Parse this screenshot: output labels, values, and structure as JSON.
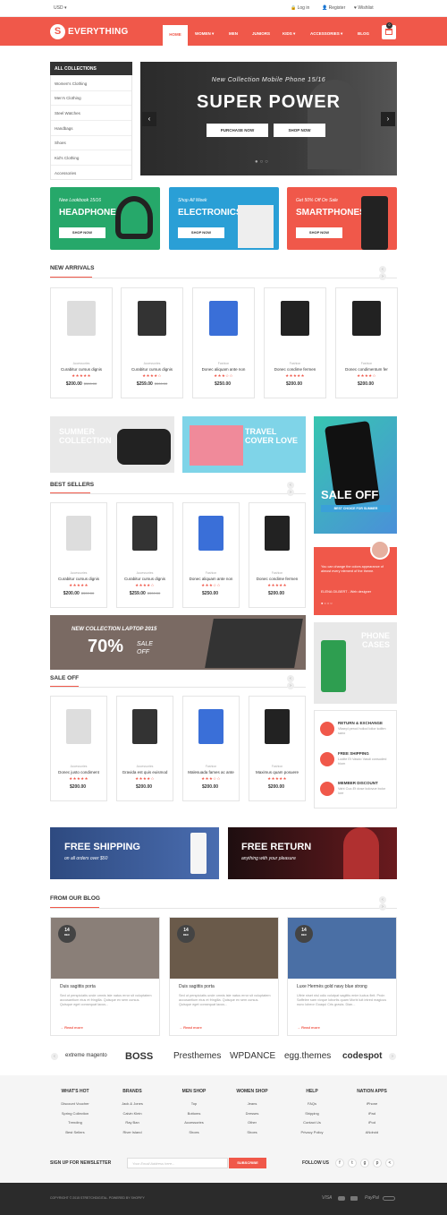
{
  "topbar": {
    "currency": "USD",
    "login": "Log in",
    "register": "Register",
    "wishlist": "Wishlist"
  },
  "header": {
    "logo": "EVERYTHING",
    "nav": [
      "HOME",
      "WOMEN",
      "MEN",
      "JUNIORS",
      "KIDS",
      "ACCESSORIES",
      "BLOG"
    ],
    "cart_count": "0"
  },
  "sidebar": {
    "title": "ALL COLLECTIONS",
    "items": [
      "Women's Clothing",
      "Men's Clothing",
      "Steel Watches",
      "Handbags",
      "Shoes",
      "Kid's Clothing",
      "Accessories"
    ]
  },
  "slider": {
    "subtitle": "New Collection Mobile Phone 15/16",
    "title": "SUPER POWER",
    "btn1": "PURCHASE NOW",
    "btn2": "SHOP NOW"
  },
  "banners": [
    {
      "sub": "New Lookbook 15/16",
      "title": "HEADPHONE",
      "btn": "SHOP NOW",
      "color": "#26a86a"
    },
    {
      "sub": "Shop All Week",
      "title": "ELECTRONICS",
      "btn": "SHOP NOW",
      "color": "#2a9fd6"
    },
    {
      "sub": "Get 50% Off On Sale",
      "title": "SMARTPHONES",
      "btn": "SHOP NOW",
      "color": "#f0584a"
    }
  ],
  "new_arrivals": {
    "title": "NEW ARRIVALS",
    "products": [
      {
        "cat": "Accessories",
        "name": "Curabitur cursus dignis",
        "stars": "★★★★★",
        "price": "$200.00",
        "old": "$300.00"
      },
      {
        "cat": "Accessories",
        "name": "Curabitur cursus dignis",
        "stars": "★★★★☆",
        "price": "$259.00",
        "old": "$300.00"
      },
      {
        "cat": "Fashion",
        "name": "Donec aliquam ante non",
        "stars": "★★★☆☆",
        "price": "$250.00",
        "old": ""
      },
      {
        "cat": "Fashion",
        "name": "Donec condime fermen",
        "stars": "★★★★★",
        "price": "$200.00",
        "old": ""
      },
      {
        "cat": "Fashion",
        "name": "Donec condimentum fer",
        "stars": "★★★★☆",
        "price": "$200.00",
        "old": ""
      }
    ]
  },
  "promo": {
    "summer": "SUMMER COLLECTION",
    "travel": "TRAVEL COVER LOVE",
    "sale": "SALE OFF",
    "sale_sub": "BEST CHOICE FOR SUMMER"
  },
  "best_sellers": {
    "title": "BEST SELLERS",
    "products": [
      {
        "cat": "Accessories",
        "name": "Curabitur cursus dignis",
        "stars": "★★★★★",
        "price": "$200.00",
        "old": "$300.00"
      },
      {
        "cat": "Accessories",
        "name": "Curabitur cursus dignis",
        "stars": "★★★★☆",
        "price": "$259.00",
        "old": "$300.00"
      },
      {
        "cat": "Fashion",
        "name": "Donec aliquam ante non",
        "stars": "★★★☆☆",
        "price": "$250.00",
        "old": ""
      },
      {
        "cat": "Fashion",
        "name": "Donec condime fermen",
        "stars": "★★★★★",
        "price": "$200.00",
        "old": ""
      }
    ]
  },
  "testimonial": {
    "text": "You can change the colors appearance of almost every element of the theme.",
    "author": "ELENA GILBERT",
    "role": "Web designer"
  },
  "laptop": {
    "sub": "NEW COLLECTION LAPTOP 2015",
    "pct": "70%",
    "sale": "SALE",
    "off": "OFF"
  },
  "phone_cases": "PHONE CASES",
  "sale_off": {
    "title": "SALE OFF",
    "products": [
      {
        "cat": "Accessories",
        "name": "Donec justo condiment",
        "stars": "★★★★★",
        "price": "$200.00",
        "old": ""
      },
      {
        "cat": "Accessories",
        "name": "Gravida est quis euismod",
        "stars": "★★★★☆",
        "price": "$200.00",
        "old": ""
      },
      {
        "cat": "Fashion",
        "name": "Malesuada fames ac ante",
        "stars": "★★★☆☆",
        "price": "$200.00",
        "old": ""
      },
      {
        "cat": "Fashion",
        "name": "Maximus quam posuere",
        "stars": "★★★★★",
        "price": "$200.00",
        "old": ""
      }
    ]
  },
  "features": [
    {
      "title": "RETURN & EXCHANGE",
      "sub": "Vitaepl perod holiod lolior kolitm sano"
    },
    {
      "title": "FREE SHIPPING",
      "sub": "Lodite Et Vasdo Vasdi consuded hiom"
    },
    {
      "title": "MEMBER DISCOUNT",
      "sub": "Vaht Cuo.Et dose kolovue bolor lore"
    }
  ],
  "wide_banners": [
    {
      "title": "FREE SHIPPING",
      "sub": "on all orders over $50"
    },
    {
      "title": "FREE RETURN",
      "sub": "anything with your pleasure"
    }
  ],
  "blog": {
    "title": "FROM OUR BLOG",
    "posts": [
      {
        "day": "14",
        "mon": "DEC",
        "title": "Duis sagittis porta",
        "text": "Sed ut perspiciatis unde omnis iste natus error sit voluptatem accusantium eius et fringilla. Quisque ex sem cursus. Quisque eget consequat lacus...",
        "more": "Read more"
      },
      {
        "day": "14",
        "mon": "DEC",
        "title": "Duis sagittis porta",
        "text": "Sed ut perspiciatis unde omnis iste natus error sit voluptatem accusantium eius et fringilla. Quisque ex sem cursus. Quisque eget consequat lacus...",
        "more": "Read more"
      },
      {
        "day": "14",
        "mon": "DEC",
        "title": "Luxe Hermès gold navy blue strong",
        "text": "Ultrie niset nisl odio volutpat sagittis enim luctus fleit. Proin Saffelee sam vivque lobortis quam Morbi luit intred magicus nunc lobeor Goaqui Cris gravia. Dian...",
        "more": "Read more"
      }
    ]
  },
  "brands": [
    "extreme magento",
    "BOSS",
    "Presthemes",
    "WPDANCE",
    "egg.themes",
    "codespot"
  ],
  "footer": {
    "cols": [
      {
        "h": "WHAT'S HOT",
        "items": [
          "Discount Voucher",
          "Spring Collection",
          "Trending",
          "Best Sellers"
        ]
      },
      {
        "h": "BRANDS",
        "items": [
          "Jack & Jones",
          "Calvin Klein",
          "Ray Ban",
          "River Island"
        ]
      },
      {
        "h": "MEN SHOP",
        "items": [
          "Top",
          "Bottoms",
          "Accessories",
          "Shoes"
        ]
      },
      {
        "h": "WOMEN SHOP",
        "items": [
          "Jeans",
          "Dresses",
          "Other",
          "Shoes"
        ]
      },
      {
        "h": "HELP",
        "items": [
          "FAQs",
          "Shipping",
          "Contact Us",
          "Privacy Policy"
        ]
      },
      {
        "h": "NATION APPS",
        "items": [
          "iPhone",
          "iPad",
          "iPod",
          "ANdroid"
        ]
      }
    ],
    "newsletter": "SIGN UP FOR NEWSLETTER",
    "news_placeholder": "Your Email Address here...",
    "subscribe": "SUBSCRIBE",
    "follow": "FOLLOW US",
    "copyright": "COPYRIGHT © 2015 STRETCHDIGITAL. POWERED BY SHOPIFY",
    "payments": [
      "VISA",
      "PayPal"
    ]
  }
}
